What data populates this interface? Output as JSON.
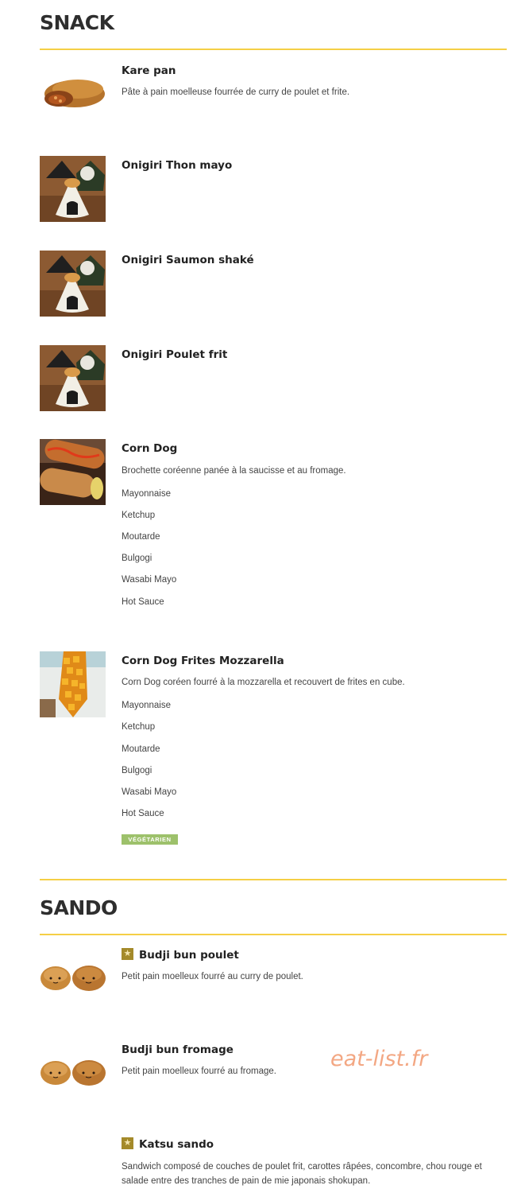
{
  "snack": {
    "title": "SNACK",
    "items": [
      {
        "name": "Kare pan",
        "description": "Pâte à pain moelleuse fourrée de curry de poulet et frite.",
        "image_icon": "kare-pan-image"
      },
      {
        "name": "Onigiri Thon mayo",
        "image_icon": "onigiri-image"
      },
      {
        "name": "Onigiri Saumon shaké",
        "image_icon": "onigiri-image"
      },
      {
        "name": "Onigiri Poulet frit",
        "image_icon": "onigiri-image"
      },
      {
        "name": "Corn Dog",
        "description": "Brochette coréenne panée à la saucisse et au fromage.",
        "options": [
          "Mayonnaise",
          "Ketchup",
          "Moutarde",
          "Bulgogi",
          "Wasabi Mayo",
          "Hot Sauce"
        ],
        "image_icon": "corn-dog-image"
      },
      {
        "name": "Corn Dog Frites Mozzarella",
        "description": "Corn Dog coréen fourré à la mozzarella et recouvert de frites en cube.",
        "options": [
          "Mayonnaise",
          "Ketchup",
          "Moutarde",
          "Bulgogi",
          "Wasabi Mayo",
          "Hot Sauce"
        ],
        "badge": "VÉGÉTARIEN",
        "image_icon": "corn-dog-fries-image"
      }
    ]
  },
  "sando": {
    "title": "SANDO",
    "items": [
      {
        "name": "Budji bun poulet",
        "description": "Petit pain moelleux fourré au curry de poulet.",
        "featured_icon": "star-icon",
        "image_icon": "budji-bun-image"
      },
      {
        "name": "Budji bun fromage",
        "description": "Petit pain moelleux fourré au fromage.",
        "image_icon": "budji-bun-image"
      },
      {
        "name": "Katsu sando",
        "description": "Sandwich composé de couches de poulet frit, carottes râpées, concombre, chou rouge et salade entre des tranches de pain de mie japonais shokupan.",
        "featured_icon": "star-icon"
      }
    ]
  },
  "watermark": "eat-list.fr",
  "colors": {
    "accent_rule": "#f5cf45",
    "badge_green": "#9dc16b",
    "star_gold": "#a48a2a",
    "watermark": "#f3a783"
  }
}
